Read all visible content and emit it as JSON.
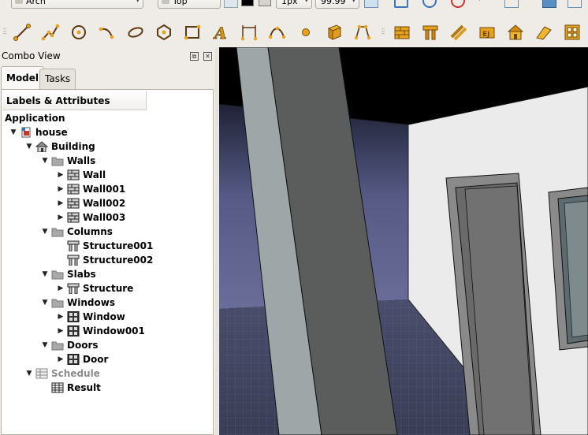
{
  "toolbar_top": {
    "workbench": "Arch",
    "view": "Top",
    "size": "1px",
    "zoom": "99.99"
  },
  "toolbar_row2": {
    "draft_tools": [
      "line-icon",
      "wire-icon",
      "circle-icon",
      "arc-icon",
      "ellipse-icon",
      "polygon-icon",
      "rectangle-icon",
      "text-icon",
      "dimension-icon",
      "bspline-icon",
      "point-icon",
      "facebinder-icon",
      "bezier-icon"
    ],
    "arch_tools": [
      "wall-icon",
      "structure-icon",
      "rebar-icon",
      "floor-icon",
      "building-icon",
      "roof-icon",
      "window-icon"
    ]
  },
  "panel": {
    "title": "Combo View",
    "tabs": [
      "Model",
      "Tasks"
    ],
    "header": "Labels & Attributes",
    "root_label": "Application"
  },
  "tree": [
    {
      "label": "house",
      "icon": "document-icon",
      "depth": 0,
      "arrow": "▼"
    },
    {
      "label": "Building",
      "icon": "building-icon",
      "depth": 1,
      "arrow": "▼"
    },
    {
      "label": "Walls",
      "icon": "folder-icon",
      "depth": 2,
      "arrow": "▼"
    },
    {
      "label": "Wall",
      "icon": "wall-icon",
      "depth": 3,
      "arrow": "▶"
    },
    {
      "label": "Wall001",
      "icon": "wall-icon",
      "depth": 3,
      "arrow": "▶"
    },
    {
      "label": "Wall002",
      "icon": "wall-icon",
      "depth": 3,
      "arrow": "▶"
    },
    {
      "label": "Wall003",
      "icon": "wall-icon",
      "depth": 3,
      "arrow": "▶"
    },
    {
      "label": "Columns",
      "icon": "folder-icon",
      "depth": 2,
      "arrow": "▼"
    },
    {
      "label": "Structure001",
      "icon": "structure-icon",
      "depth": 3,
      "arrow": ""
    },
    {
      "label": "Structure002",
      "icon": "structure-icon",
      "depth": 3,
      "arrow": ""
    },
    {
      "label": "Slabs",
      "icon": "folder-icon",
      "depth": 2,
      "arrow": "▼"
    },
    {
      "label": "Structure",
      "icon": "structure-icon",
      "depth": 3,
      "arrow": "▶"
    },
    {
      "label": "Windows",
      "icon": "folder-icon",
      "depth": 2,
      "arrow": "▼"
    },
    {
      "label": "Window",
      "icon": "window-icon",
      "depth": 3,
      "arrow": "▶"
    },
    {
      "label": "Window001",
      "icon": "window-icon",
      "depth": 3,
      "arrow": "▶"
    },
    {
      "label": "Doors",
      "icon": "folder-icon",
      "depth": 2,
      "arrow": "▼"
    },
    {
      "label": "Door",
      "icon": "window-icon",
      "depth": 3,
      "arrow": "▶"
    },
    {
      "label": "Schedule",
      "icon": "schedule-icon",
      "depth": 1,
      "arrow": "▼",
      "muted": true
    },
    {
      "label": "Result",
      "icon": "spreadsheet-icon",
      "depth": 2,
      "arrow": ""
    }
  ],
  "colors": {
    "background": "#efebe7",
    "sky": "#262a3f",
    "floor": "#4f5374",
    "column": "#5b5e5d",
    "wall": "#e9e9e9"
  }
}
